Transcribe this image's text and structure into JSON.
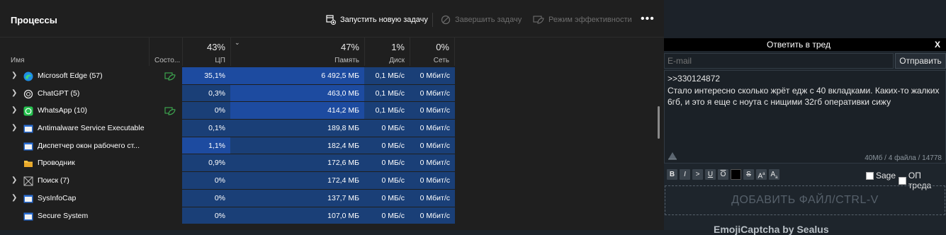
{
  "task_manager": {
    "title": "Процессы",
    "toolbar": {
      "new_task": "Запустить новую задачу",
      "end_task": "Завершить задачу",
      "efficiency": "Режим эффективности",
      "more": "•••"
    },
    "columns": {
      "name": "Имя",
      "status": "Состо...",
      "cpu_pct": "43%",
      "cpu": "ЦП",
      "mem_pct": "47%",
      "mem": "Память",
      "disk_pct": "1%",
      "disk": "Диск",
      "net_pct": "0%",
      "net": "Сеть"
    },
    "rows": [
      {
        "name": "Microsoft Edge (57)",
        "icon": "edge-icon",
        "expand": true,
        "eco": true,
        "cpu": "35,1%",
        "mem": "6 492,5 МБ",
        "disk": "0,1 МБ/с",
        "net": "0 Мбит/с"
      },
      {
        "name": "ChatGPT (5)",
        "icon": "chatgpt-icon",
        "expand": true,
        "eco": false,
        "cpu": "0,3%",
        "mem": "463,0 МБ",
        "disk": "0,1 МБ/с",
        "net": "0 Мбит/с"
      },
      {
        "name": "WhatsApp (10)",
        "icon": "whatsapp-icon",
        "expand": true,
        "eco": true,
        "cpu": "0%",
        "mem": "414,2 МБ",
        "disk": "0,1 МБ/с",
        "net": "0 Мбит/с"
      },
      {
        "name": "Antimalware Service Executable",
        "icon": "window-icon",
        "expand": true,
        "eco": false,
        "cpu": "0,1%",
        "mem": "189,8 МБ",
        "disk": "0 МБ/с",
        "net": "0 Мбит/с"
      },
      {
        "name": "Диспетчер окон рабочего ст...",
        "icon": "window-icon",
        "expand": false,
        "eco": false,
        "cpu": "1,1%",
        "mem": "182,4 МБ",
        "disk": "0 МБ/с",
        "net": "0 Мбит/с"
      },
      {
        "name": "Проводник",
        "icon": "folder-icon",
        "expand": false,
        "eco": false,
        "cpu": "0,9%",
        "mem": "172,6 МБ",
        "disk": "0 МБ/с",
        "net": "0 Мбит/с"
      },
      {
        "name": "Поиск (7)",
        "icon": "search-icon",
        "expand": true,
        "eco": false,
        "cpu": "0%",
        "mem": "172,4 МБ",
        "disk": "0 МБ/с",
        "net": "0 Мбит/с"
      },
      {
        "name": "SysInfoCap",
        "icon": "window-icon",
        "expand": true,
        "eco": false,
        "cpu": "0%",
        "mem": "137,7 МБ",
        "disk": "0 МБ/с",
        "net": "0 Мбит/с"
      },
      {
        "name": "Secure System",
        "icon": "window-icon",
        "expand": false,
        "eco": false,
        "cpu": "0%",
        "mem": "107,0 МБ",
        "disk": "0 МБ/с",
        "net": "0 Мбит/с"
      }
    ],
    "colors": {
      "heat_low": "#16325c",
      "heat_mid": "#1a3f77",
      "heat_high": "#1d4ba0"
    }
  },
  "reply_form": {
    "title": "Ответить в тред",
    "close": "X",
    "email_placeholder": "E-mail",
    "send": "Отправить",
    "message_lines": [
      ">>330124872",
      "Стало интересно сколько жрёт едж с 40 вкладками. Каких-то жалких",
      "6гб, и это я еще с ноута с нищими 32гб оперативки сижу"
    ],
    "counter": "40Мб / 4 файла / 14778",
    "format_buttons": [
      "B",
      "I",
      ">",
      "U",
      "O",
      "",
      "S",
      "A",
      "A"
    ],
    "sage": "Sage",
    "op": "ОП треда",
    "add_file": "ДОБАВИТЬ ФАЙЛ/CTRL-V",
    "captcha": "EmojiCaptcha by Sealus"
  }
}
